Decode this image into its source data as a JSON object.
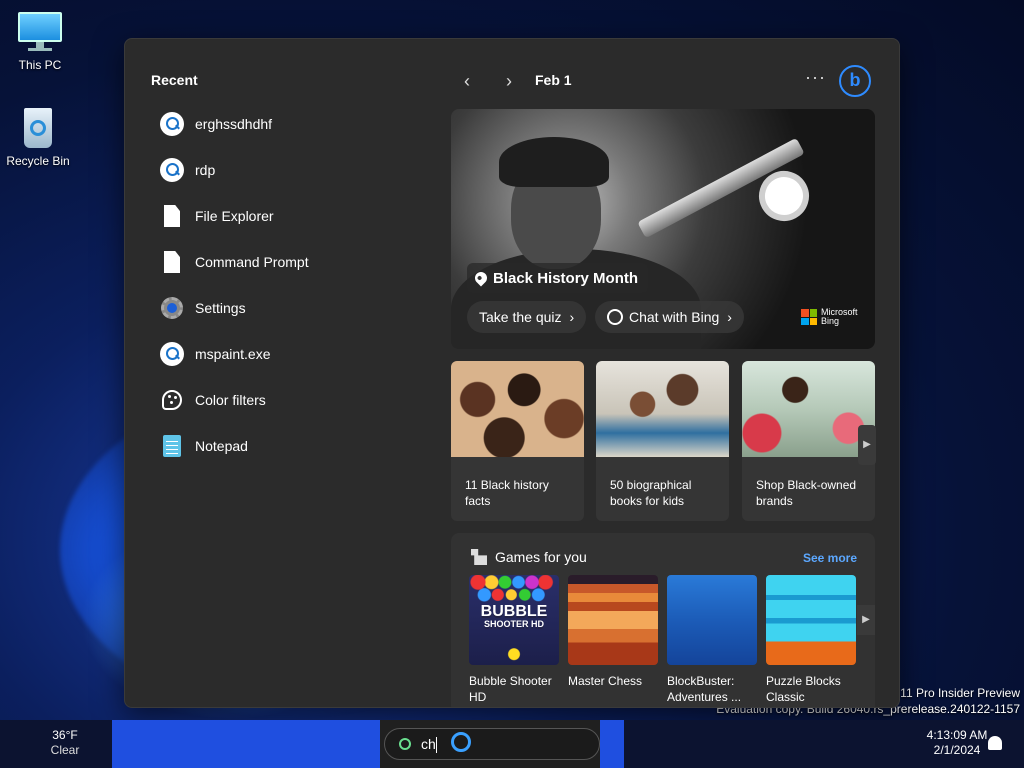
{
  "desktop": {
    "icons": [
      {
        "label": "This PC",
        "icon": "monitor-icon"
      },
      {
        "label": "Recycle Bin",
        "icon": "recycle-bin-icon"
      }
    ],
    "watermark_line1": "11 Pro Insider Preview",
    "watermark_line2": "Evaluation copy. Build 26040.rs_prerelease.240122-1157"
  },
  "recent": {
    "title": "Recent",
    "items": [
      {
        "label": "erghssdhdhf",
        "icon": "search-icon"
      },
      {
        "label": "rdp",
        "icon": "search-icon"
      },
      {
        "label": "File Explorer",
        "icon": "document-icon"
      },
      {
        "label": "Command Prompt",
        "icon": "document-icon"
      },
      {
        "label": "Settings",
        "icon": "gear-icon"
      },
      {
        "label": "mspaint.exe",
        "icon": "search-icon"
      },
      {
        "label": "Color filters",
        "icon": "palette-icon"
      },
      {
        "label": "Notepad",
        "icon": "notepad-icon"
      }
    ]
  },
  "nav": {
    "prev": "‹",
    "next": "›",
    "date": "Feb 1",
    "more": "···",
    "bing": "b"
  },
  "hero": {
    "label": "Black History Month",
    "quiz_button": "Take the quiz",
    "chat_button": "Chat with Bing",
    "brand_line1": "Microsoft",
    "brand_line2": "Bing"
  },
  "cards": [
    {
      "text": "11 Black history facts",
      "line1": "11 Black history",
      "line2": "facts"
    },
    {
      "text": "50 biographical books for kids",
      "line1": "50 biographical",
      "line2": "books for kids"
    },
    {
      "text": "Shop Black-owned brands",
      "line1": "Shop Black-owned",
      "line2": "brands"
    }
  ],
  "games": {
    "title": "Games for you",
    "see_more": "See more",
    "items": [
      {
        "line1": "Bubble Shooter",
        "line2": "HD"
      },
      {
        "line1": "Master Chess",
        "line2": ""
      },
      {
        "line1": "BlockBuster:",
        "line2": "Adventures ..."
      },
      {
        "line1": "Puzzle Blocks",
        "line2": "Classic"
      }
    ],
    "bubble_logo_line1": "BUBBLE",
    "bubble_logo_line2": "SHOOTER HD"
  },
  "taskbar": {
    "weather_temp": "36°F",
    "weather_desc": "Clear",
    "search_query": "ch",
    "time": "4:13:09 AM",
    "date": "2/1/2024"
  },
  "colors": {
    "accent": "#2e8bff",
    "link": "#5ca8ff",
    "panel_bg": "#2b2b2b"
  }
}
